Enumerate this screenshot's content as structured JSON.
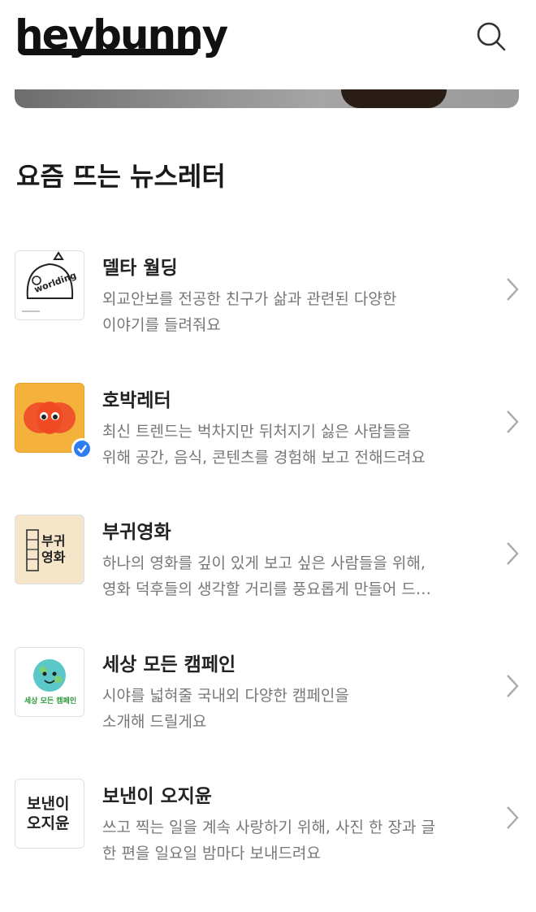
{
  "header": {
    "logo": "heybunny",
    "search_icon": "search-icon"
  },
  "section": {
    "title": "요즘 뜨는 뉴스레터"
  },
  "newsletters": [
    {
      "name": "델타 월딩",
      "desc1": "외교안보를 전공한 친구가 삶과 관련된 다양한",
      "desc2": "이야기를 들려줘요",
      "thumb_text": "worlding"
    },
    {
      "name": "호박레터",
      "desc1": "최신 트렌드는 벅차지만 뒤처지기 싫은 사람들을",
      "desc2": "위해 공간, 음식, 콘텐츠를 경험해 보고 전해드려요",
      "verified": true
    },
    {
      "name": "부귀영화",
      "desc1": "하나의 영화를 깊이 있게 보고 싶은 사람들을 위해,",
      "desc2": "영화 덕후들의 생각할 거리를 풍요롭게 만들어 드…",
      "thumb_text": "부귀영화"
    },
    {
      "name": "세상 모든 캠페인",
      "desc1": "시야를 넓혀줄 국내외 다양한 캠페인을",
      "desc2": "소개해 드릴게요",
      "thumb_text": "세상 모든 캠페인"
    },
    {
      "name": "보낸이 오지윤",
      "desc1": "쓰고 찍는 일을 계속 사랑하기 위해, 사진 한 장과 글",
      "desc2": "한 편을 일요일 밤마다 보내드려요",
      "thumb_text": "보낸이 오지윤"
    }
  ],
  "colors": {
    "text_primary": "#222222",
    "text_secondary": "#777777",
    "badge_blue": "#2d7df0",
    "pumpkin_bg": "#f4b23d"
  }
}
